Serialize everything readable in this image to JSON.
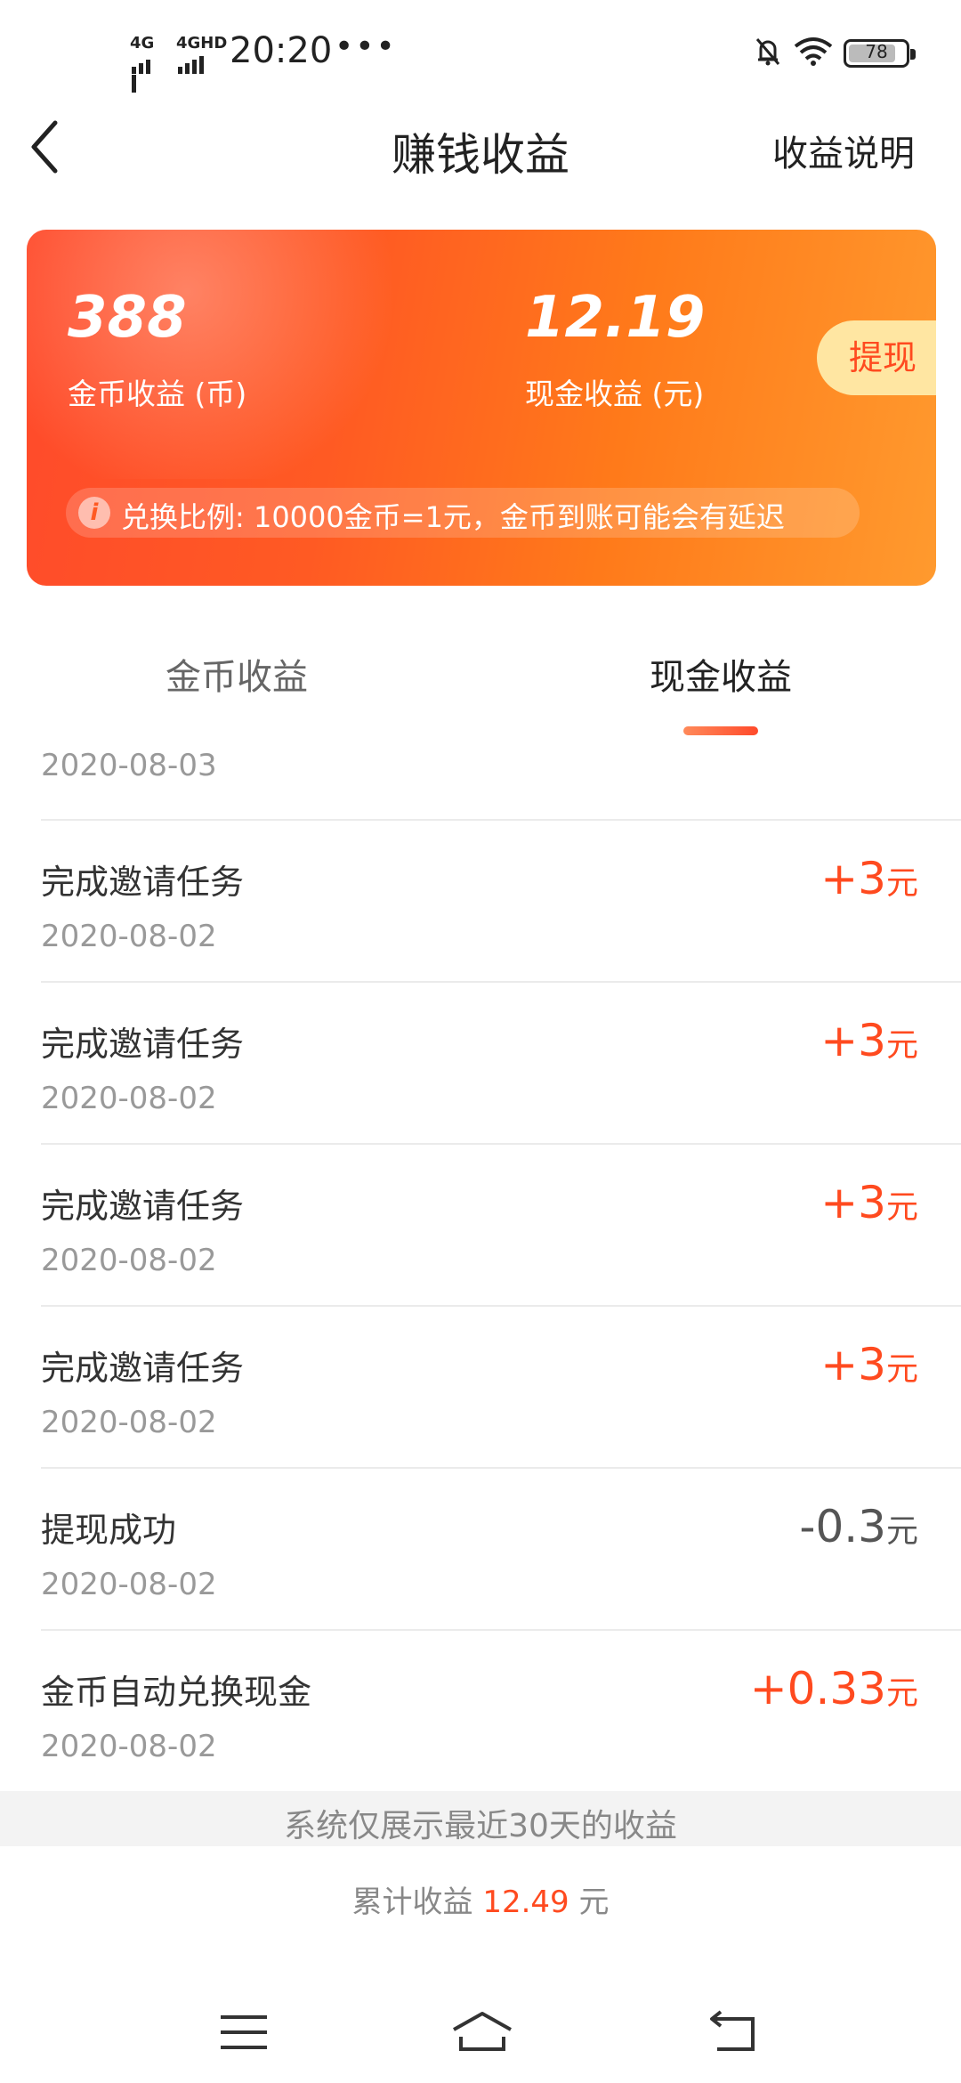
{
  "status_bar": {
    "sig1": "4G",
    "sig2": "4GHD",
    "time": "20:20",
    "more": "•••",
    "battery": "78"
  },
  "nav": {
    "title": "赚钱收益",
    "help": "收益说明"
  },
  "card": {
    "coin_value": "388",
    "coin_label": "金币收益 (币)",
    "cash_value": "12.19",
    "cash_label": "现金收益 (元)",
    "withdraw_label": "提现",
    "rate_text": "兑换比例: 10000金币=1元，金币到账可能会有延迟"
  },
  "tabs": [
    {
      "label": "金币收益",
      "active": false
    },
    {
      "label": "现金收益",
      "active": true
    }
  ],
  "list": {
    "partial_date": "2020-08-03",
    "items": [
      {
        "title": "完成邀请任务",
        "date": "2020-08-02",
        "amount": "+3",
        "unit": "元"
      },
      {
        "title": "完成邀请任务",
        "date": "2020-08-02",
        "amount": "+3",
        "unit": "元"
      },
      {
        "title": "完成邀请任务",
        "date": "2020-08-02",
        "amount": "+3",
        "unit": "元"
      },
      {
        "title": "完成邀请任务",
        "date": "2020-08-02",
        "amount": "+3",
        "unit": "元"
      },
      {
        "title": "提现成功",
        "date": "2020-08-02",
        "amount": "-0.3",
        "unit": "元"
      },
      {
        "title": "金币自动兑换现金",
        "date": "2020-08-02",
        "amount": "+0.33",
        "unit": "元"
      }
    ]
  },
  "footer": {
    "notice": "系统仅展示最近30天的收益",
    "total_label": "累计收益",
    "total_value": "12.49",
    "total_unit": "元"
  },
  "colors": {
    "accent": "#ff4a1f",
    "card_start": "#ff4a2b",
    "card_end": "#ff9a2e",
    "withdraw_bg": "#ffe6a2"
  }
}
